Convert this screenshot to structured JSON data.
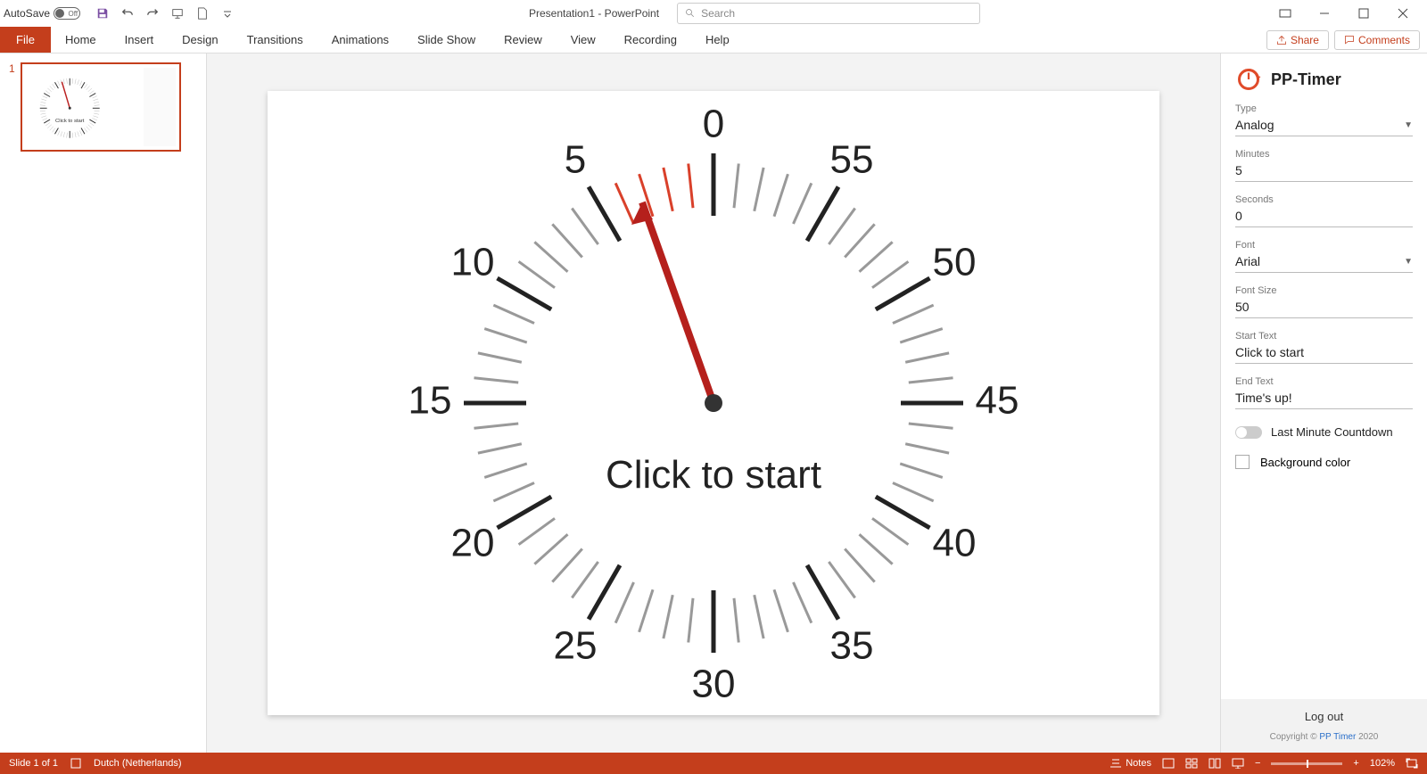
{
  "titlebar": {
    "autosave_label": "AutoSave",
    "autosave_state": "Off",
    "doc_title": "Presentation1 - PowerPoint",
    "search_placeholder": "Search"
  },
  "ribbon": {
    "file": "File",
    "tabs": [
      "Home",
      "Insert",
      "Design",
      "Transitions",
      "Animations",
      "Slide Show",
      "Review",
      "View",
      "Recording",
      "Help"
    ],
    "share": "Share",
    "comments": "Comments"
  },
  "thumbnails": {
    "slide_number": "1"
  },
  "clock": {
    "numbers": {
      "n0": "0",
      "n5": "5",
      "n10": "10",
      "n15": "15",
      "n20": "20",
      "n25": "25",
      "n30": "30",
      "n35": "35",
      "n40": "40",
      "n45": "45",
      "n50": "50",
      "n55": "55"
    },
    "start_text": "Click to start"
  },
  "pane": {
    "title": "PP-Timer",
    "type_label": "Type",
    "type_value": "Analog",
    "minutes_label": "Minutes",
    "minutes_value": "5",
    "seconds_label": "Seconds",
    "seconds_value": "0",
    "font_label": "Font",
    "font_value": "Arial",
    "fontsize_label": "Font Size",
    "fontsize_value": "50",
    "starttext_label": "Start Text",
    "starttext_value": "Click to start",
    "endtext_label": "End Text",
    "endtext_value": "Time's up!",
    "lastmin_label": "Last Minute Countdown",
    "bgcolor_label": "Background color",
    "logout": "Log out",
    "copyright_prefix": "Copyright © ",
    "copyright_link": "PP Timer",
    "copyright_suffix": " 2020"
  },
  "statusbar": {
    "slide_info": "Slide 1 of 1",
    "language": "Dutch (Netherlands)",
    "notes": "Notes",
    "zoom": "102%"
  }
}
